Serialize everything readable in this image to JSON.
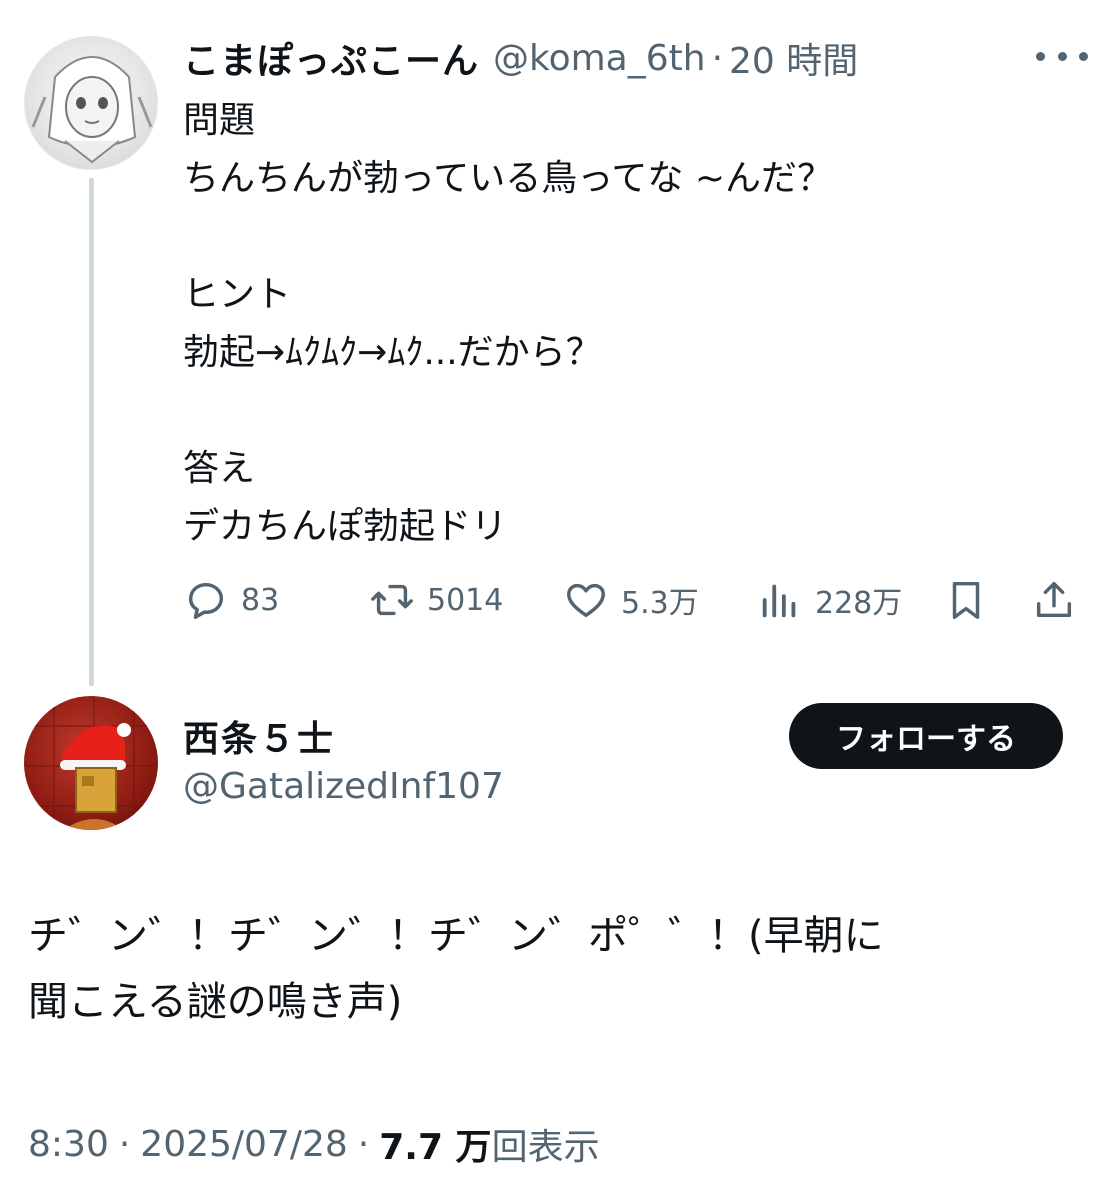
{
  "quoted_tweet": {
    "author_name": "こまぽっぷこーん",
    "author_handle": "@koma_6th",
    "separator": "·",
    "time": "20 時間",
    "text": "問題\nちんちんが勃っている鳥ってな ~んだ？\n\nヒント\n勃起→ﾑｸﾑｸ→ﾑｸ...だから？\n\n答え\nデカちんぽ勃起ドリ",
    "stats": {
      "replies": "83",
      "retweets": "5014",
      "likes": "5.3万",
      "views": "228万"
    },
    "icons": [
      "reply-icon",
      "retweet-icon",
      "like-icon",
      "views-icon",
      "bookmark-icon",
      "share-icon",
      "more-icon"
    ]
  },
  "reply_tweet": {
    "author_name": "西条５士",
    "author_handle": "@GatalizedInf107",
    "follow_label": "フォローする",
    "text": "チ゛ン゛！チ゛ン゛！チ゛ン゛ポ゜゛！(早朝に\n聞こえる謎の鳴き声)",
    "time": "8:30",
    "date": "2025/07/28",
    "separator": "·",
    "views_count": "7.7 万",
    "views_label": "回表示"
  },
  "colors": {
    "text": "#0f1419",
    "secondary": "#536471",
    "thread_line": "#cfd9de",
    "follow_button_bg": "#0f1419"
  }
}
